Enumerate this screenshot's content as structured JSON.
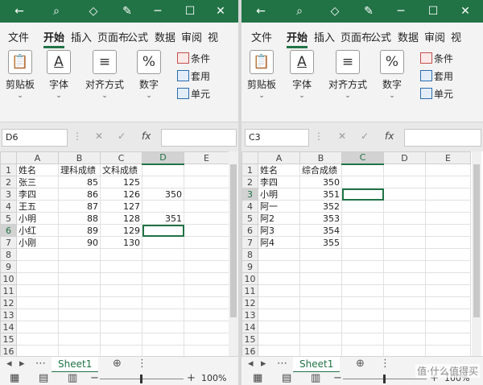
{
  "icons": {
    "back": "back-arrow-icon",
    "search": "search-icon",
    "diamond": "diamond-icon",
    "pen": "pen-icon",
    "minimize": "minimize-icon",
    "maximize": "maximize-icon",
    "close": "close-icon"
  },
  "ribbon_tabs": [
    "文件",
    "开始",
    "插入",
    "页面布",
    "公式",
    "数据",
    "审阅",
    "视"
  ],
  "ribbon_groups": {
    "clipboard": "剪贴板",
    "font": "字体",
    "alignment": "对齐方式",
    "number": "数字",
    "number_symbol": "%",
    "styles": [
      "条件",
      "套用",
      "单元"
    ]
  },
  "formula_bar": {
    "fx": "fx"
  },
  "left": {
    "cell_ref": "D6",
    "columns": [
      "A",
      "B",
      "C",
      "D",
      "E"
    ],
    "rows": [
      [
        "1",
        "姓名",
        "理科成绩",
        "文科成绩",
        "",
        ""
      ],
      [
        "2",
        "张三",
        "85",
        "125",
        "",
        ""
      ],
      [
        "3",
        "李四",
        "86",
        "126",
        "350",
        ""
      ],
      [
        "4",
        "王五",
        "87",
        "127",
        "",
        ""
      ],
      [
        "5",
        "小明",
        "88",
        "128",
        "351",
        ""
      ],
      [
        "6",
        "小红",
        "89",
        "129",
        "",
        ""
      ],
      [
        "7",
        "小刚",
        "90",
        "130",
        "",
        ""
      ],
      [
        "8",
        "",
        "",
        "",
        "",
        ""
      ],
      [
        "9",
        "",
        "",
        "",
        "",
        ""
      ],
      [
        "10",
        "",
        "",
        "",
        "",
        ""
      ],
      [
        "11",
        "",
        "",
        "",
        "",
        ""
      ],
      [
        "12",
        "",
        "",
        "",
        "",
        ""
      ],
      [
        "13",
        "",
        "",
        "",
        "",
        ""
      ],
      [
        "14",
        "",
        "",
        "",
        "",
        ""
      ],
      [
        "15",
        "",
        "",
        "",
        "",
        ""
      ],
      [
        "16",
        "",
        "",
        "",
        "",
        ""
      ]
    ],
    "sheet_tab": "Sheet1",
    "zoom": "100%"
  },
  "right": {
    "cell_ref": "C3",
    "columns": [
      "A",
      "B",
      "C",
      "D",
      "E"
    ],
    "rows": [
      [
        "1",
        "姓名",
        "综合成绩",
        "",
        "",
        ""
      ],
      [
        "2",
        "李四",
        "350",
        "",
        "",
        ""
      ],
      [
        "3",
        "小明",
        "351",
        "",
        "",
        ""
      ],
      [
        "4",
        "阿一",
        "352",
        "",
        "",
        ""
      ],
      [
        "5",
        "阿2",
        "353",
        "",
        "",
        ""
      ],
      [
        "6",
        "阿3",
        "354",
        "",
        "",
        ""
      ],
      [
        "7",
        "阿4",
        "355",
        "",
        "",
        ""
      ],
      [
        "8",
        "",
        "",
        "",
        "",
        ""
      ],
      [
        "9",
        "",
        "",
        "",
        "",
        ""
      ],
      [
        "10",
        "",
        "",
        "",
        "",
        ""
      ],
      [
        "11",
        "",
        "",
        "",
        "",
        ""
      ],
      [
        "12",
        "",
        "",
        "",
        "",
        ""
      ],
      [
        "13",
        "",
        "",
        "",
        "",
        ""
      ],
      [
        "14",
        "",
        "",
        "",
        "",
        ""
      ],
      [
        "15",
        "",
        "",
        "",
        "",
        ""
      ],
      [
        "16",
        "",
        "",
        "",
        "",
        ""
      ]
    ],
    "sheet_tab": "Sheet1",
    "zoom": "100%"
  },
  "watermark": "值·什么值得买",
  "colors": {
    "accent": "#217346",
    "title_bar": "#217346",
    "ribbon_bg": "#f3f3f3"
  }
}
